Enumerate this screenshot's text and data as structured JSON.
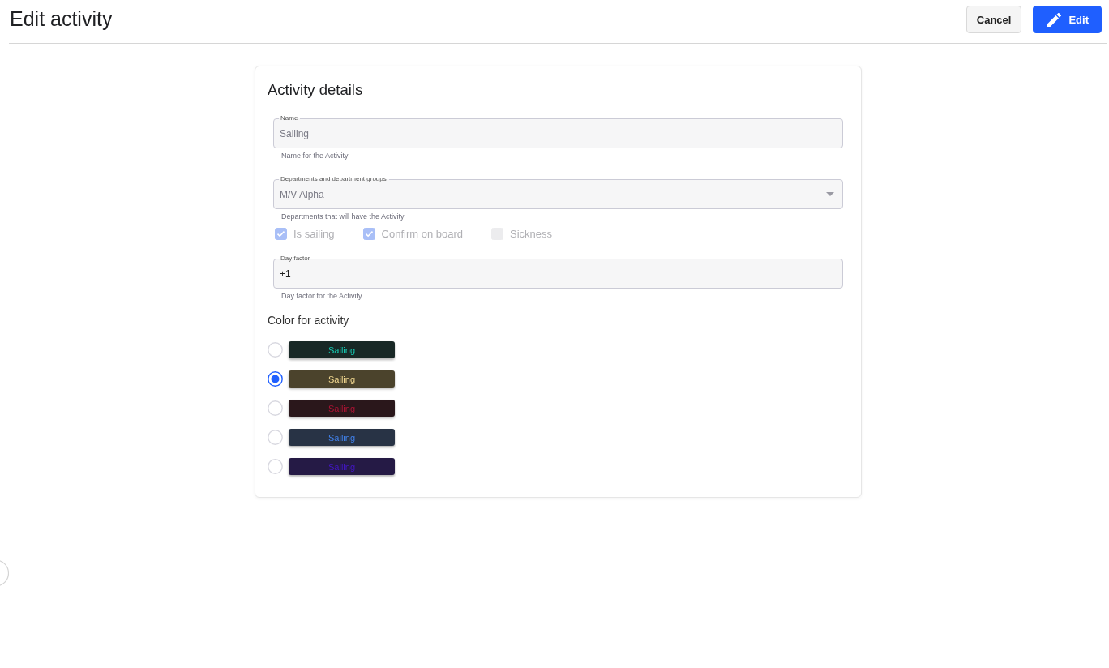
{
  "header": {
    "title": "Edit activity",
    "buttons": [
      {
        "label": "Cancel",
        "kind": "cancel"
      },
      {
        "label": "Edit",
        "kind": "edit"
      }
    ]
  },
  "card": {
    "title": "Activity details",
    "fields": [
      {
        "kind": "text",
        "label": "Name",
        "value": "Sailing",
        "hint": "Name for the Activity",
        "disabled": true
      },
      {
        "kind": "select",
        "label": "Departments and department groups",
        "value": "M/V Alpha",
        "hint": "Departments that will have the Activity",
        "disabled": true
      },
      {
        "kind": "checkboxes",
        "options": [
          {
            "label": "Is sailing",
            "checked": true,
            "disabled": true
          },
          {
            "label": "Confirm on board",
            "checked": true,
            "disabled": true
          },
          {
            "label": "Sickness",
            "checked": false,
            "disabled": true
          }
        ]
      },
      {
        "kind": "text",
        "label": "Day factor",
        "value": "+1",
        "hint": "Day factor for the Activity",
        "disabled": false
      }
    ],
    "color_section": {
      "title": "Color for activity",
      "options": [
        {
          "label": "Sailing",
          "color": "#182826",
          "selected": false
        },
        {
          "label": "Sailing",
          "color": "#4b432c",
          "selected": true
        },
        {
          "label": "Sailing",
          "color": "#2a171b",
          "selected": false
        },
        {
          "label": "Sailing",
          "color": "#283345",
          "selected": false
        },
        {
          "label": "Sailing",
          "color": "#251a45",
          "selected": false
        }
      ]
    }
  }
}
